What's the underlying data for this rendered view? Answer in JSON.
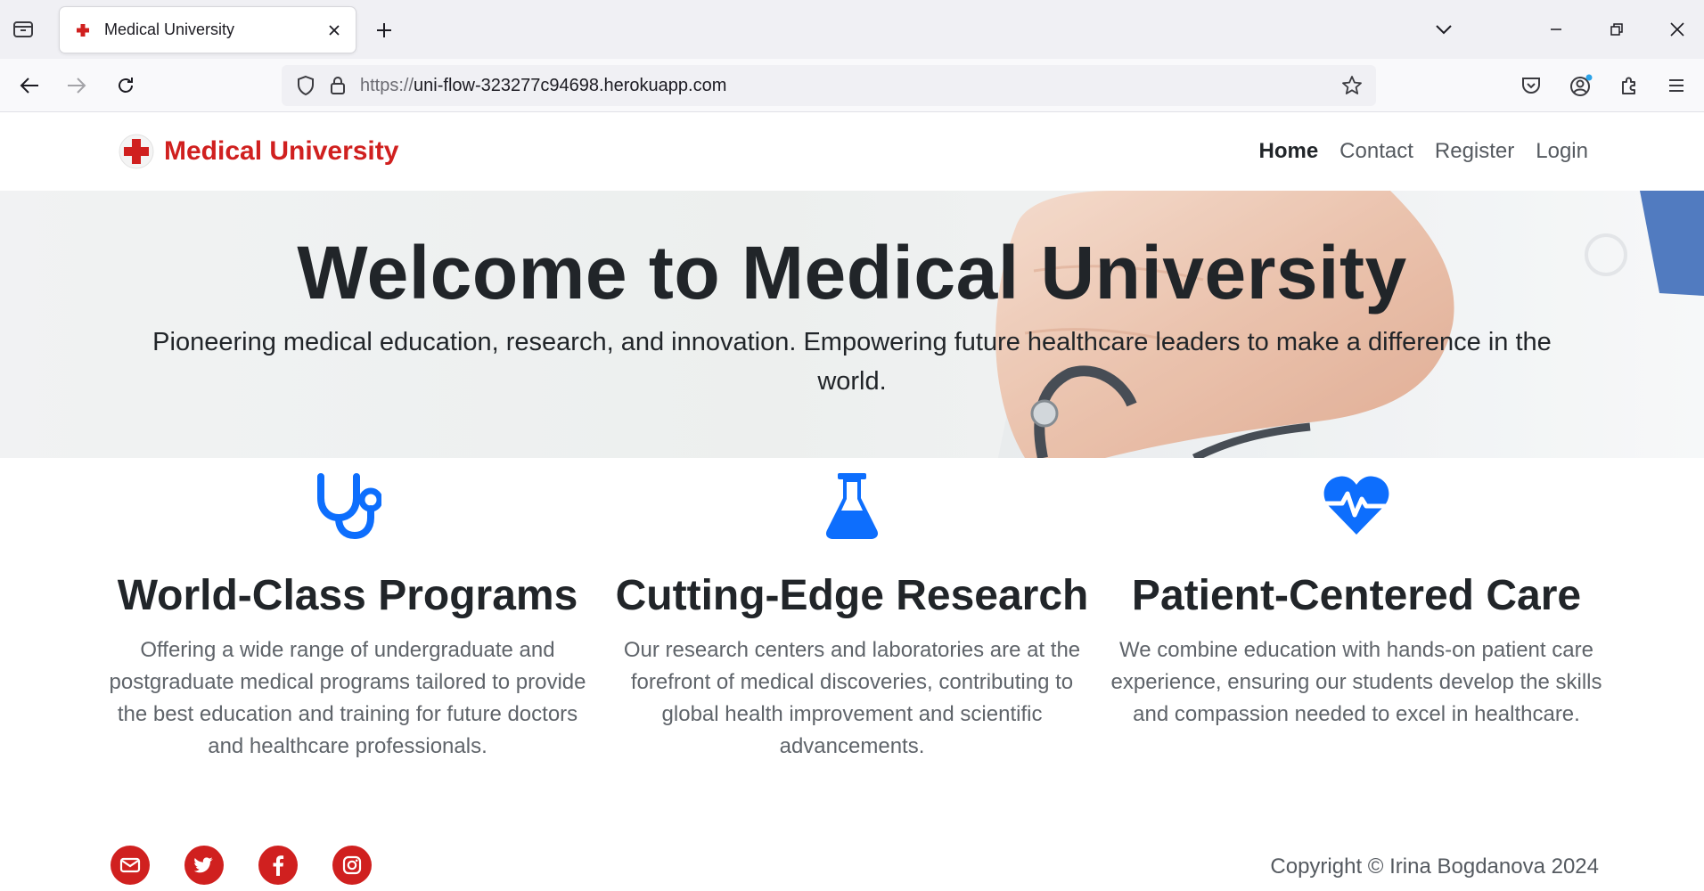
{
  "browser": {
    "tab_title": "Medical University",
    "url_scheme": "https://",
    "url_host": "uni-flow-323277c94698.herokuapp.com"
  },
  "site": {
    "brand": "Medical University",
    "nav": {
      "home": "Home",
      "contact": "Contact",
      "register": "Register",
      "login": "Login"
    },
    "hero": {
      "title": "Welcome to Medical University",
      "subtitle": "Pioneering medical education, research, and innovation. Empowering future healthcare leaders to make a difference in the world."
    },
    "features": [
      {
        "icon": "stethoscope-icon",
        "title": "World-Class Programs",
        "text": "Offering a wide range of undergraduate and postgraduate medical programs tailored to provide the best education and training for future doctors and healthcare professionals."
      },
      {
        "icon": "flask-icon",
        "title": "Cutting-Edge Research",
        "text": "Our research centers and laboratories are at the forefront of medical discoveries, contributing to global health improvement and scientific advancements."
      },
      {
        "icon": "heart-pulse-icon",
        "title": "Patient-Centered Care",
        "text": "We combine education with hands-on patient care experience, ensuring our students develop the skills and compassion needed to excel in healthcare."
      }
    ],
    "footer": {
      "social": [
        "email-icon",
        "twitter-icon",
        "facebook-icon",
        "instagram-icon"
      ],
      "copyright": "Copyright © Irina Bogdanova 2024"
    }
  },
  "colors": {
    "brand_red": "#d0201f",
    "icon_blue": "#0d6efd",
    "text_dark": "#212529",
    "text_muted": "#5f646a"
  }
}
